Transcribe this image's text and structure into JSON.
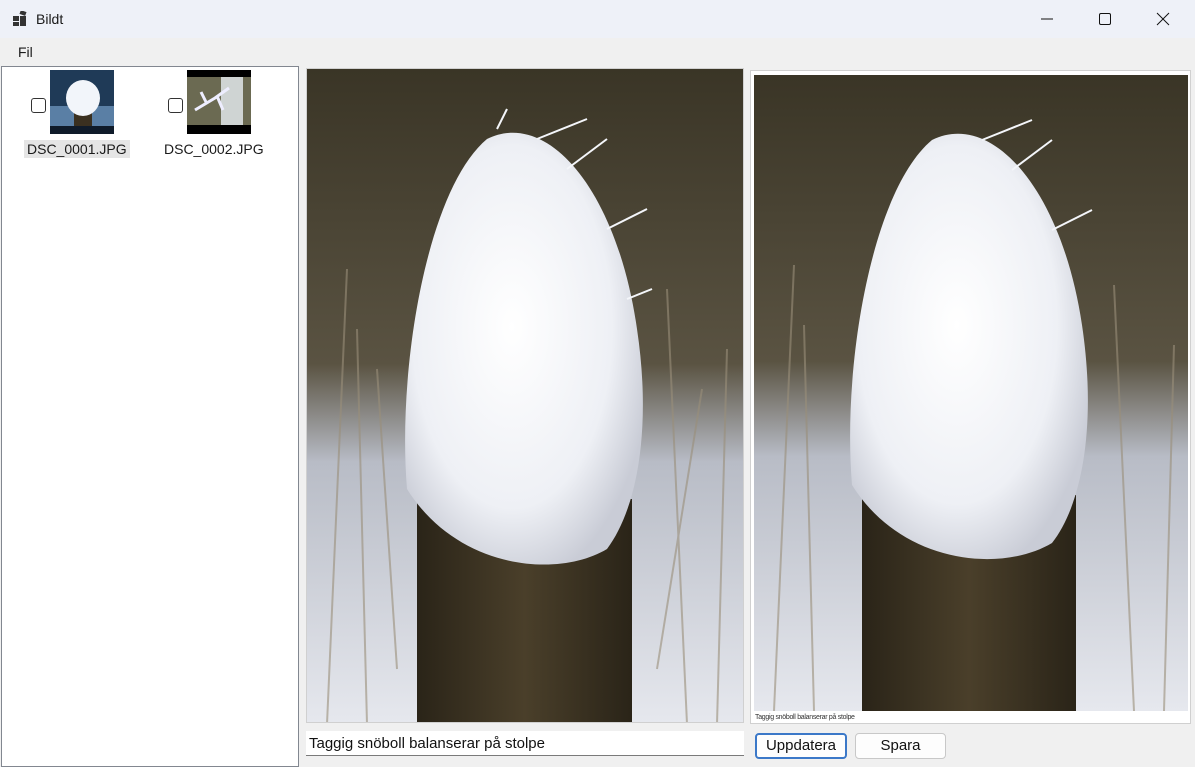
{
  "window": {
    "title": "Bildt",
    "icon": "app-window-icon"
  },
  "menu": {
    "items": [
      {
        "label": "Fil"
      }
    ]
  },
  "list": {
    "items": [
      {
        "label": "DSC_0001.JPG",
        "checked": false,
        "selected": true,
        "thumb": "snowball-on-post"
      },
      {
        "label": "DSC_0002.JPG",
        "checked": false,
        "selected": false,
        "thumb": "frosted-branch"
      }
    ]
  },
  "preview": {
    "caption_overlay": "Taggig snöboll balanserar på stolpe"
  },
  "editor": {
    "caption_value": "Taggig snöboll balanserar på stolpe",
    "update_label": "Uppdatera",
    "save_label": "Spara"
  }
}
